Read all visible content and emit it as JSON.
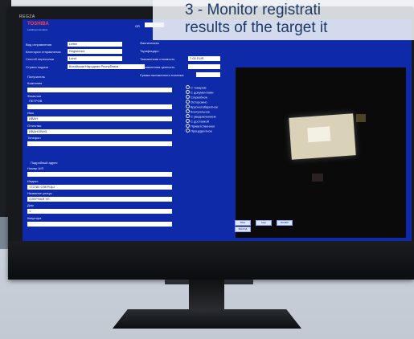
{
  "caption": {
    "line1": "3 - Monitor registrati",
    "line2": "results of the target it"
  },
  "monitor": {
    "brand": "REGZA"
  },
  "app": {
    "logo": "TOSHIBA",
    "logo_sub": "Leading Innovation",
    "gr_label": "GR"
  },
  "form": {
    "ship_type_label": "Вид отправления",
    "ship_type_value": "Letter",
    "category_label": "Категория отправления",
    "category_value": "Registered",
    "method_label": "Способ пересылки",
    "method_value": "Land",
    "country_label": "Страна подачи",
    "country_value": "Китайская Народная Республика",
    "actual_label": "Фактическая",
    "payer_label": "Тарифициро",
    "shipping_value_label": "Таможенная стоимость",
    "shipping_value": "7.00 EUR",
    "declared_value_label": "Объявленная ценность",
    "cod_label": "Сумма наложенного платежа",
    "recipient_section": "Получатель",
    "company_label": "Компания",
    "surname_label": "Фамилия",
    "surname_value": "ПЕТРОВ",
    "name_label": "Имя",
    "name_value": "ИВАН",
    "patronymic_label": "Отчество",
    "patronymic_value": "ИВАНОВИЧ",
    "phone_label": "Телефон",
    "address_section": "Подробный адрес",
    "po_box_label": "Номер А/Я",
    "index_label": "Индекс",
    "index_value": "172780 ОЗЕРЦЫ",
    "street_label": "Название улицы",
    "street_value": "ОЗЕРНАЯ УЛ",
    "house_label": "Дом",
    "house_value": "1",
    "apartment_label": "Квартира"
  },
  "options": [
    "С товарам",
    "С документами",
    "Служебное",
    "Осторожно",
    "Крупногабаритное",
    "Контрольное",
    "С уведомлением",
    "С доставкой",
    "Приветственное",
    "Прецедентное"
  ],
  "buttons": {
    "b1": "ВСЕ",
    "b2": "Закр",
    "b3": "ВОЗВР",
    "b4": "ВЫХОД"
  }
}
